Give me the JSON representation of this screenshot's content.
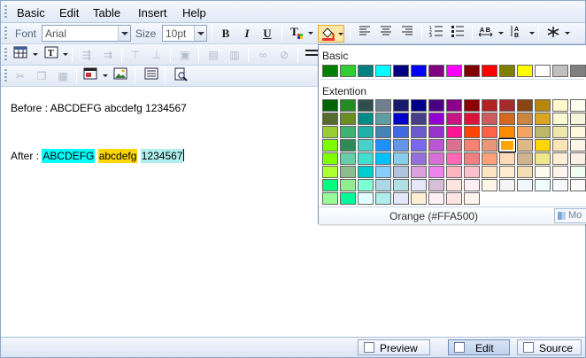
{
  "menu": [
    "Basic",
    "Edit",
    "Table",
    "Insert",
    "Help"
  ],
  "toolbar": {
    "font_label": "Font",
    "font_value": "Arial",
    "size_label": "Size",
    "size_value": "10pt",
    "bold": "B",
    "italic": "I",
    "underline": "U"
  },
  "content": {
    "before_text": "Before : ABCDEFG abcdefg 1234567",
    "after_label": "After : ",
    "after_segments": [
      {
        "text": "ABCDEFG",
        "bg": "#00ffff"
      },
      {
        "text": " ",
        "bg": ""
      },
      {
        "text": "abcdefg",
        "bg": "#ffd700"
      },
      {
        "text": " ",
        "bg": ""
      },
      {
        "text": "1234567",
        "bg": "#afeeee"
      }
    ]
  },
  "color_popup": {
    "basic_label": "Basic",
    "extension_label": "Extention",
    "selected_name": "Orange (#FFA500)",
    "more_label": "Mo",
    "basic_colors": [
      "#008000",
      "#32cd32",
      "#008080",
      "#00ffff",
      "#000080",
      "#0000ff",
      "#800080",
      "#ff00ff",
      "#800000",
      "#ff0000",
      "#808000",
      "#ffff00",
      "#ffffff",
      "#c0c0c0",
      "#808080"
    ],
    "extension_colors": [
      "#006400",
      "#228b22",
      "#2f4f4f",
      "#708090",
      "#191970",
      "#00008b",
      "#4b0082",
      "#8b008b",
      "#8b0000",
      "#b22222",
      "#a52a2a",
      "#8b4513",
      "#b8860b",
      "#fffacd",
      "#fffff0",
      "#556b2f",
      "#6b8e23",
      "#008b8b",
      "#5f9ea0",
      "#0000cd",
      "#483d8b",
      "#9400d3",
      "#c71585",
      "#dc143c",
      "#cd5c5c",
      "#d2691e",
      "#cd853f",
      "#daa520",
      "#fafad2",
      "#f5f5dc",
      "#9acd32",
      "#3cb371",
      "#20b2aa",
      "#4682b4",
      "#4169e1",
      "#6a5acd",
      "#9932cc",
      "#ff1493",
      "#ff4500",
      "#ff6347",
      "#ff8c00",
      "#f4a460",
      "#bdb76b",
      "#eee8aa",
      "#fff8dc",
      "#7cfc00",
      "#2e8b57",
      "#48d1cc",
      "#1e90ff",
      "#6495ed",
      "#7b68ee",
      "#ba55d3",
      "#db7093",
      "#fa8072",
      "#e9967a",
      "#ffa500",
      "#deb887",
      "#ffd700",
      "#ffe4b5",
      "#fdf5e6",
      "#7fff00",
      "#66cdaa",
      "#40e0d0",
      "#00bfff",
      "#87ceeb",
      "#9370db",
      "#da70d6",
      "#ff69b4",
      "#f08080",
      "#ffa07a",
      "#ffdab9",
      "#d2b48c",
      "#f0e68c",
      "#ffefd5",
      "#faf0e6",
      "#adff2f",
      "#8fbc8f",
      "#00ced1",
      "#87cefa",
      "#b0c4de",
      "#dda0dd",
      "#ee82ee",
      "#ffb6c1",
      "#ffc0cb",
      "#ffe4c4",
      "#ffebcd",
      "#f5deb3",
      "#fffaf0",
      "#fff5ee",
      "#f0fff0",
      "#00ff7f",
      "#90ee90",
      "#7fffd4",
      "#add8e6",
      "#b0e0e6",
      "#e6e6fa",
      "#d8bfd8",
      "#ffe4e1",
      "#fff0f5",
      "#fdf5e6",
      "#f5f5f5",
      "#f0f8ff",
      "#f0ffff",
      "#f8f8ff",
      "#fffafa",
      "#98fb98",
      "#00fa9a",
      "#e0ffff",
      "#afeeee",
      "#e6e6fa",
      "#ffefd5",
      "#fff0f5",
      "#ffe4e1",
      "#fff5ee"
    ],
    "selected_index": 55
  },
  "statusbar": {
    "preview": "Preview",
    "edit": "Edit",
    "source": "Source"
  }
}
